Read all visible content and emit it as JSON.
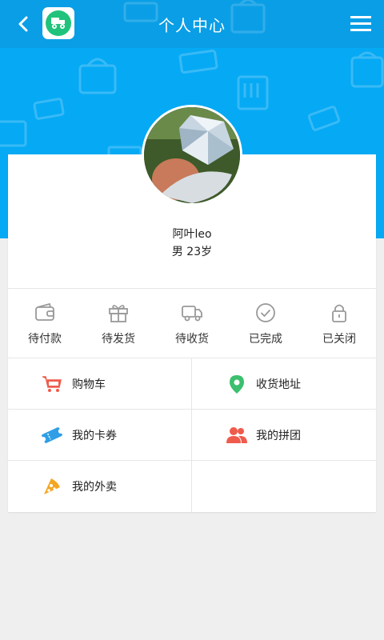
{
  "header": {
    "title": "个人中心",
    "colors": {
      "bar": "#0a9ee6",
      "hero": "#06a9f4",
      "app": "#21c37c"
    }
  },
  "profile": {
    "name": "阿叶leo",
    "gender_age": "男 23岁"
  },
  "orders": [
    {
      "label": "待付款",
      "icon": "wallet-icon"
    },
    {
      "label": "待发货",
      "icon": "gift-icon"
    },
    {
      "label": "待收货",
      "icon": "truck-icon"
    },
    {
      "label": "已完成",
      "icon": "check-circle-icon"
    },
    {
      "label": "已关闭",
      "icon": "lock-icon"
    }
  ],
  "menu": [
    {
      "label": "购物车",
      "icon": "cart-icon",
      "color": "#ef5b4c"
    },
    {
      "label": "收货地址",
      "icon": "location-pin-icon",
      "color": "#3cbf6e"
    },
    {
      "label": "我的卡券",
      "icon": "ticket-icon",
      "color": "#2f9ee6"
    },
    {
      "label": "我的拼团",
      "icon": "group-icon",
      "color": "#ef5b4c"
    },
    {
      "label": "我的外卖",
      "icon": "pizza-icon",
      "color": "#f4a623"
    }
  ]
}
